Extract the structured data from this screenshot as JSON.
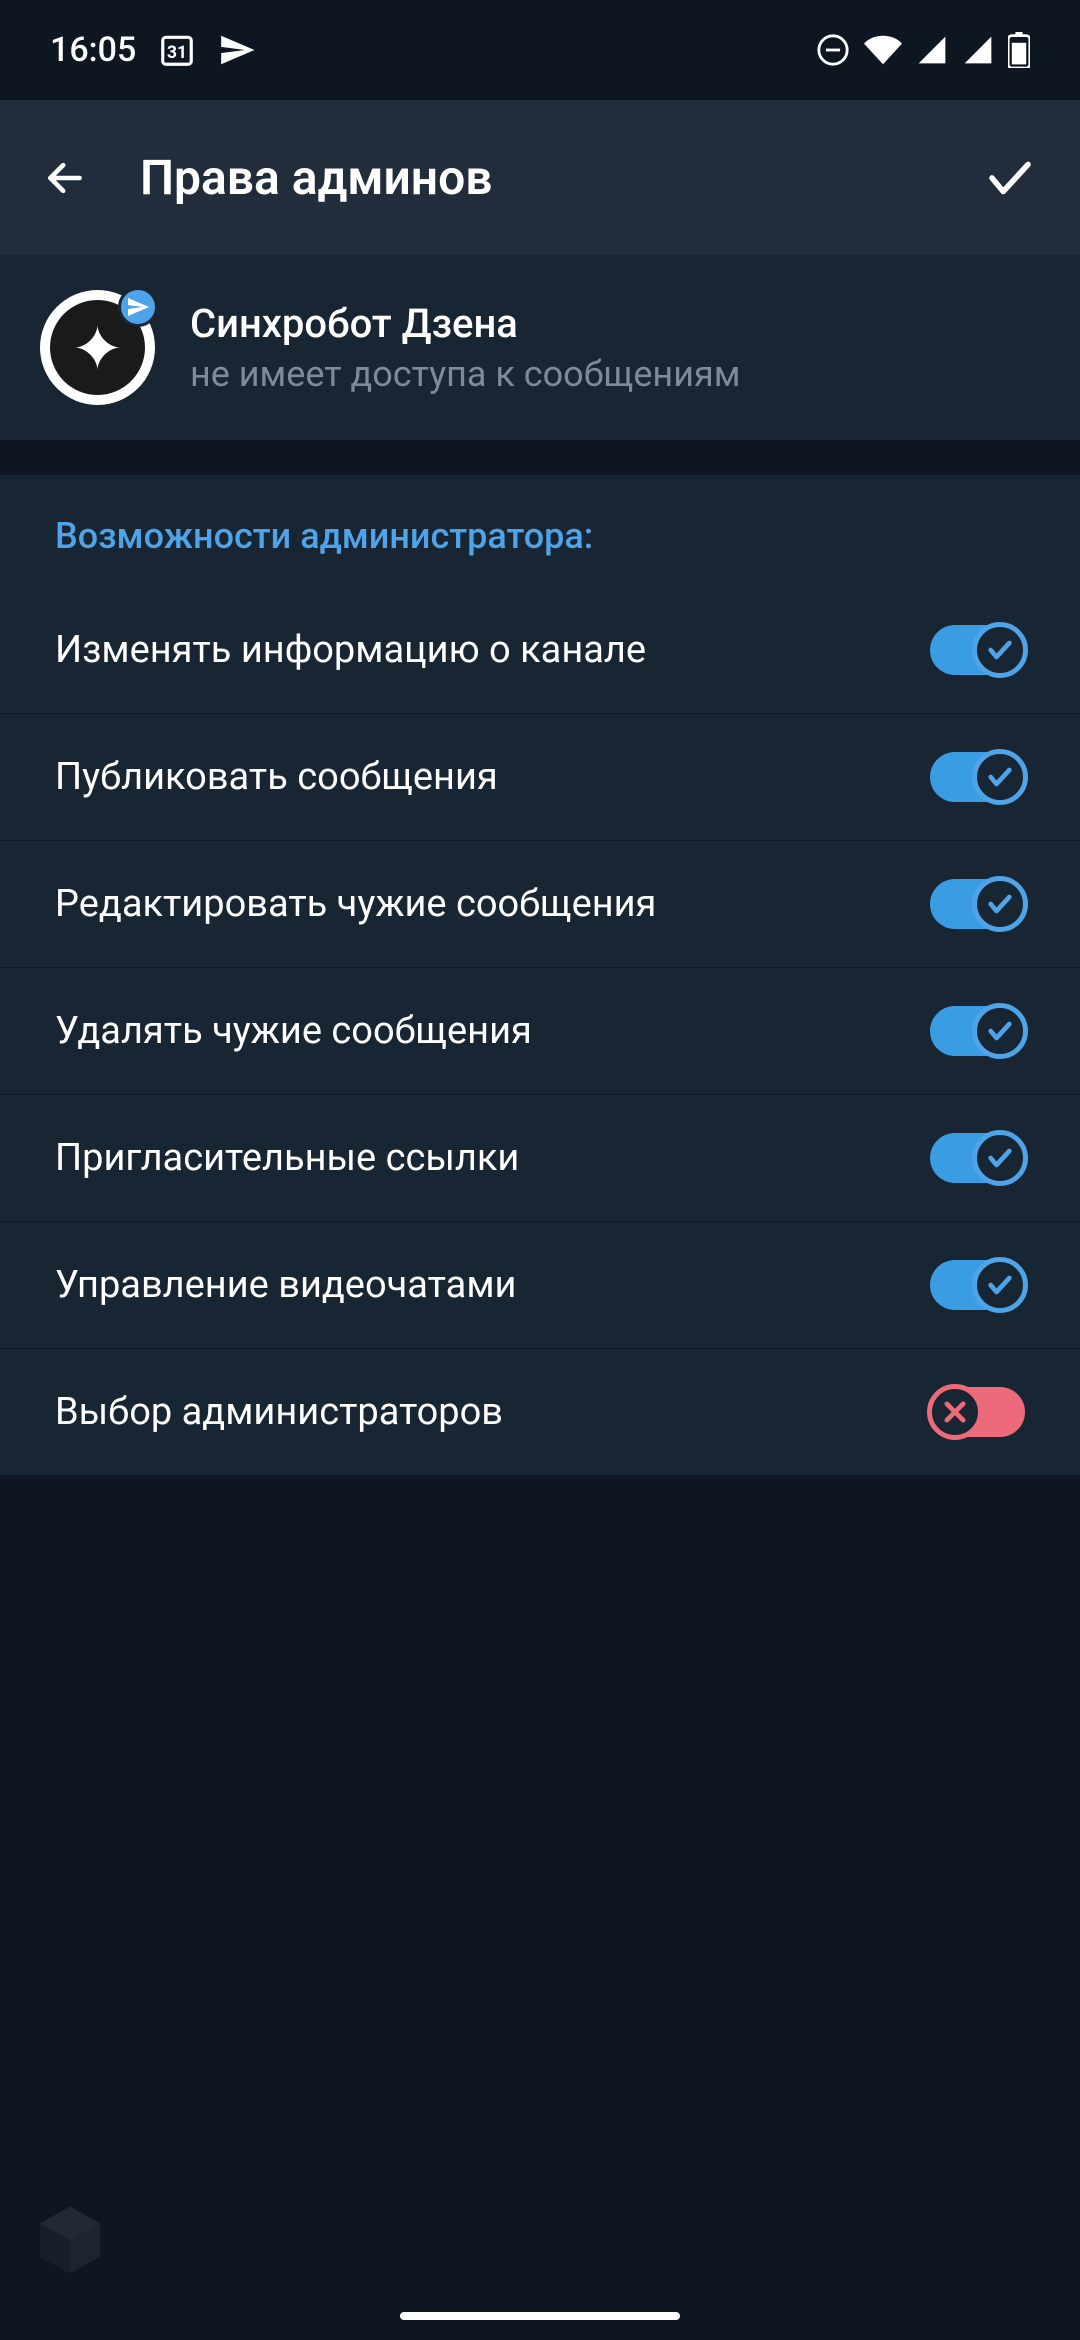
{
  "status_bar": {
    "time": "16:05",
    "calendar_day": "31"
  },
  "header": {
    "title": "Права админов"
  },
  "profile": {
    "name": "Синхробот Дзена",
    "subtitle": "не имеет доступа к сообщениям"
  },
  "section": {
    "title": "Возможности администратора:"
  },
  "permissions": [
    {
      "label": "Изменять информацию о канале",
      "enabled": true
    },
    {
      "label": "Публиковать сообщения",
      "enabled": true
    },
    {
      "label": "Редактировать чужие сообщения",
      "enabled": true
    },
    {
      "label": "Удалять чужие сообщения",
      "enabled": true
    },
    {
      "label": "Пригласительные ссылки",
      "enabled": true
    },
    {
      "label": "Управление видеочатами",
      "enabled": true
    },
    {
      "label": "Выбор администраторов",
      "enabled": false
    }
  ]
}
